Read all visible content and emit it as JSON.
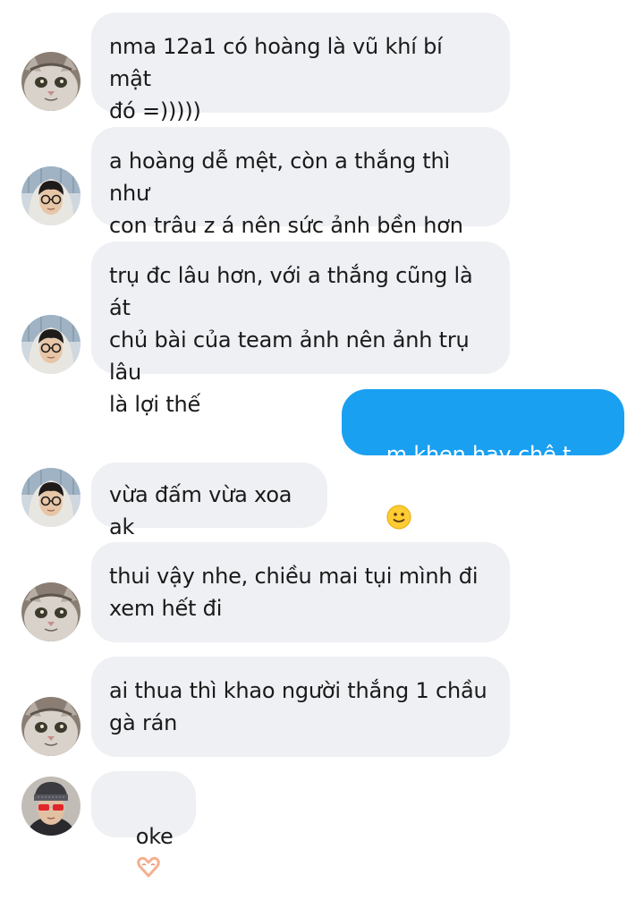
{
  "messages": [
    {
      "sender": "cat",
      "text": "nma 12a1 có hoàng là vũ khí bí mật\nđó =)))))"
    },
    {
      "sender": "boy-hoodie",
      "text": "a hoàng dễ mệt, còn a thắng thì như\ncon trâu z á nên sức ảnh bền hơn"
    },
    {
      "sender": "boy-hoodie",
      "text": "trụ đc lâu hơn, với a thắng cũng là át\nchủ bài của team ảnh nên ảnh trụ lâu\nlà lợi thế"
    },
    {
      "sender": "me",
      "text": "m khen hay chê t vậy",
      "emoji": "slightly-smiling-face-emoji"
    },
    {
      "sender": "boy-hoodie",
      "text": "vừa đấm vừa xoa ak"
    },
    {
      "sender": "cat",
      "text": "thui vậy nhe, chiều mai tụi mình đi\nxem hết đi"
    },
    {
      "sender": "cat",
      "text": "ai thua thì khao người thắng 1 chầu\ngà rán"
    },
    {
      "sender": "boy-sunglasses",
      "text": "oke",
      "emoji": "heart-hands-emoji"
    }
  ],
  "colors": {
    "incoming_bubble": "#eef0f3",
    "outgoing_bubble": "#1aa0f0",
    "incoming_text": "#1a1a1a",
    "outgoing_text": "#ffffff"
  }
}
